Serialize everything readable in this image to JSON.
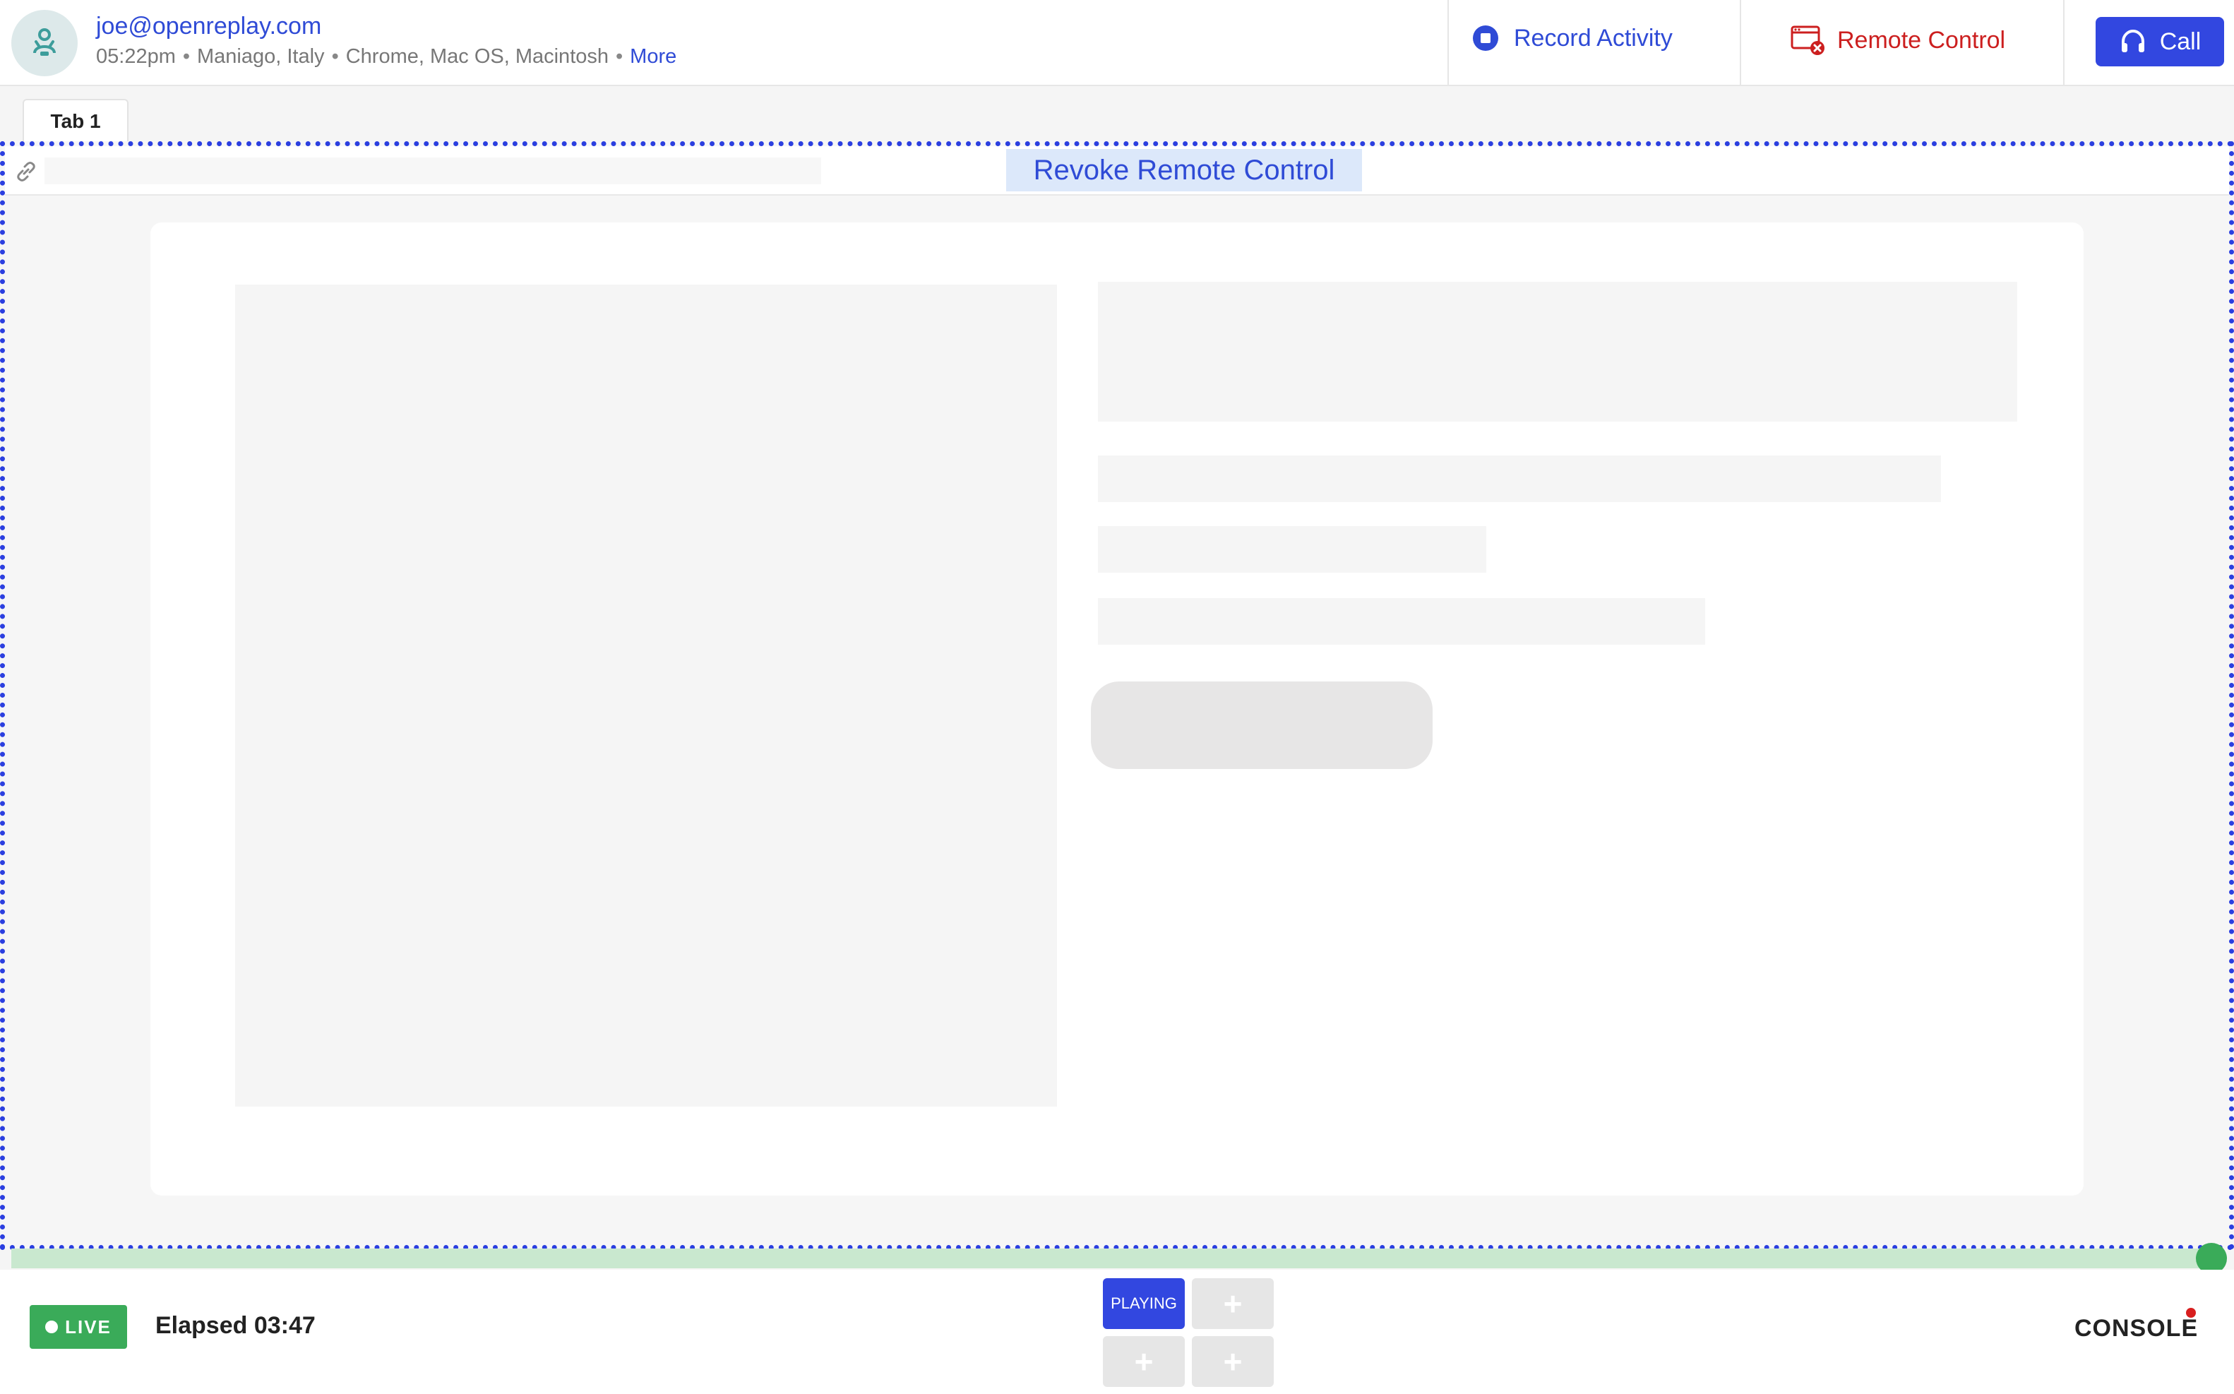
{
  "header": {
    "user_email": "joe@openreplay.com",
    "time": "05:22pm",
    "location": "Maniago, Italy",
    "environment": "Chrome, Mac OS, Macintosh",
    "more_label": "More",
    "record_label": "Record Activity",
    "remote_label": "Remote Control",
    "call_label": "Call"
  },
  "tabs": [
    {
      "label": "Tab 1"
    }
  ],
  "remote": {
    "revoke_label": "Revoke Remote Control"
  },
  "footer": {
    "live_label": "LIVE",
    "elapsed": "Elapsed 03:47",
    "playing_label": "PLAYING",
    "add_glyph": "+",
    "console_label": "CONSOLE"
  },
  "colors": {
    "accent": "#2f4bd6",
    "call_bg": "#3247e0",
    "remote_red": "#cc1f1f",
    "live_green": "#3aab59",
    "revoke_bg": "#dce8fa",
    "frame_dots": "#2b3fe0"
  },
  "icons": {
    "avatar": "user-support-icon",
    "record": "record-stop-icon",
    "remote": "remote-window-close-icon",
    "call": "headset-icon",
    "link": "link-icon"
  }
}
